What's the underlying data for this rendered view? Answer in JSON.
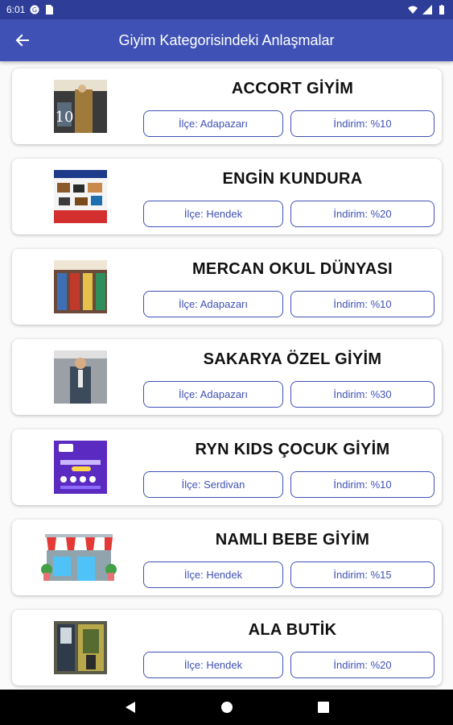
{
  "status_bar": {
    "time": "6:01"
  },
  "app_bar": {
    "title": "Giyim Kategorisindeki Anlaşmalar"
  },
  "colors": {
    "primary": "#3f51b5",
    "status": "#2e3e98"
  },
  "deals": [
    {
      "name": "ACCORT GİYİM",
      "district": "İlçe: Adapazarı",
      "discount": "İndirim: %10",
      "thumb": "clothing-photo"
    },
    {
      "name": "ENGİN KUNDURA",
      "district": "İlçe: Hendek",
      "discount": "İndirim: %20",
      "thumb": "shoes-photo"
    },
    {
      "name": "MERCAN OKUL DÜNYASI",
      "district": "İlçe: Adapazarı",
      "discount": "İndirim: %10",
      "thumb": "school-store-photo"
    },
    {
      "name": "SAKARYA ÖZEL GİYİM",
      "district": "İlçe: Adapazarı",
      "discount": "İndirim: %30",
      "thumb": "suit-photo"
    },
    {
      "name": "RYN KIDS ÇOCUK GİYİM",
      "district": "İlçe: Serdivan",
      "discount": "İndirim: %10",
      "thumb": "purple-ad"
    },
    {
      "name": "NAMLI BEBE GİYİM",
      "district": "İlçe: Hendek",
      "discount": "İndirim: %15",
      "thumb": "storefront-icon"
    },
    {
      "name": "ALA BUTİK",
      "district": "İlçe: Hendek",
      "discount": "İndirim: %20",
      "thumb": "boutique-photo"
    }
  ]
}
